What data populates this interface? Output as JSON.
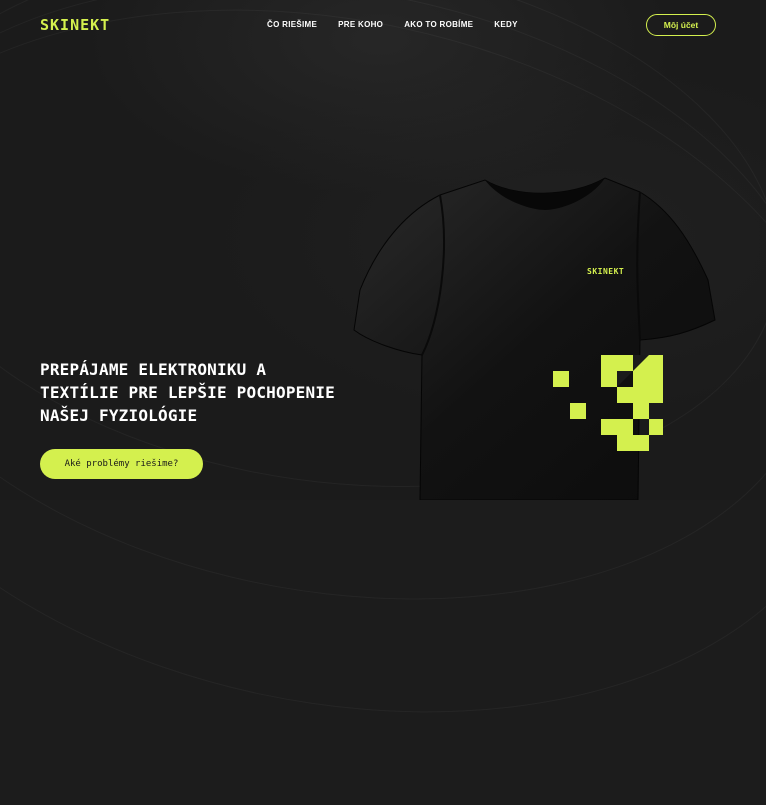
{
  "brand": {
    "logo_text": "SKINEKT",
    "accent_color": "#d4f04e"
  },
  "nav": {
    "items": [
      {
        "label": "ČO RIEŠIME"
      },
      {
        "label": "PRE KOHO"
      },
      {
        "label": "AKO TO ROBÍME"
      },
      {
        "label": "KEDY"
      }
    ]
  },
  "header": {
    "account_label": "Môj účet"
  },
  "hero": {
    "title_lines": [
      "PREPÁJAME ELEKTRONIKU A",
      "TEXTÍLIE PRE LEPŠIE POCHOPENIE",
      "NAŠEJ FYZIOLÓGIE"
    ],
    "cta_label": "Aké problémy riešime?",
    "shirt_logo_text": "SKINEKT"
  }
}
